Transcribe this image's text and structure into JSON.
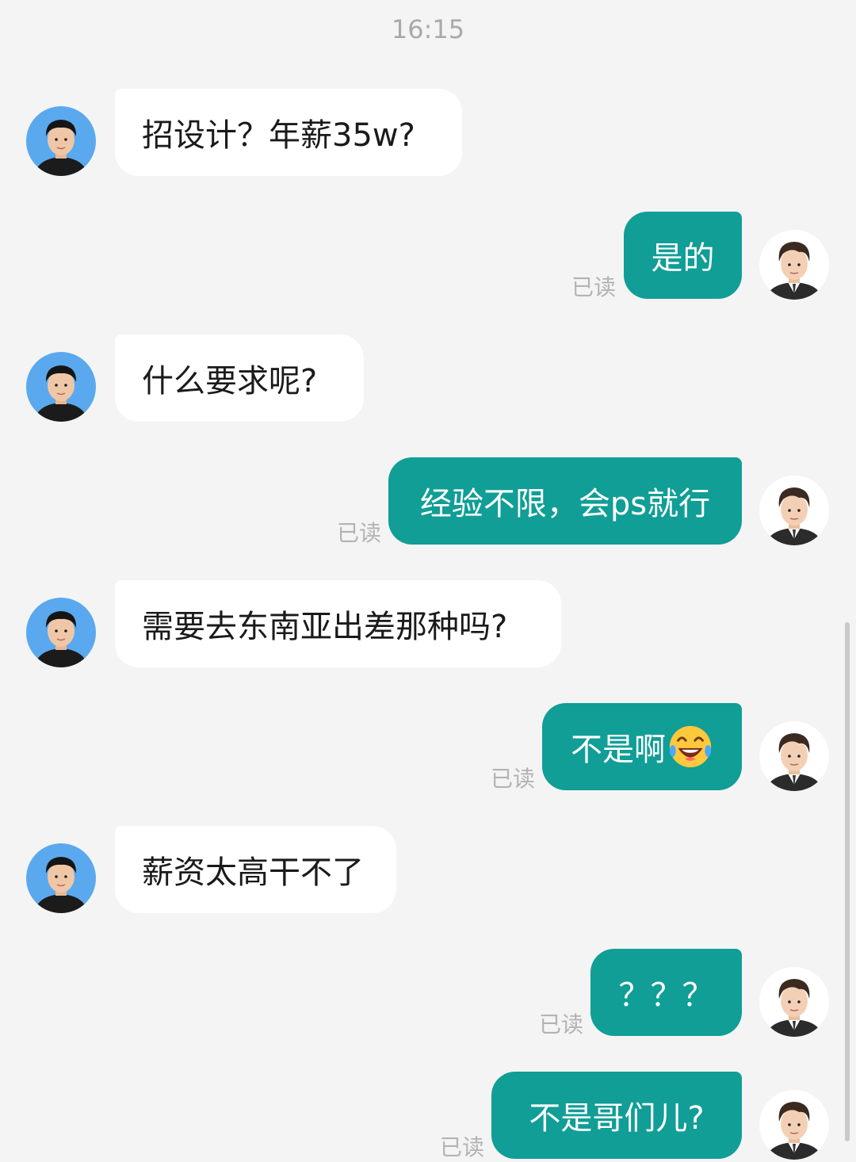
{
  "chat": {
    "timestamp": "16:15",
    "read_label": "已读",
    "messages": [
      {
        "side": "left",
        "text": "招设计？年薪35w?"
      },
      {
        "side": "right",
        "text": "是的"
      },
      {
        "side": "left",
        "text": "什么要求呢?"
      },
      {
        "side": "right",
        "text": "经验不限，会ps就行"
      },
      {
        "side": "left",
        "text": "需要去东南亚出差那种吗?"
      },
      {
        "side": "right",
        "text": "不是啊",
        "emoji": "laughing-tears-emoji"
      },
      {
        "side": "left",
        "text": "薪资太高干不了"
      },
      {
        "side": "right",
        "text": "？？？"
      },
      {
        "side": "right",
        "text": "不是哥们儿?"
      }
    ]
  },
  "colors": {
    "background": "#f4f4f4",
    "incoming_bubble": "#ffffff",
    "outgoing_bubble": "#109e96",
    "read_receipt": "#b3b3b3",
    "avatar_left_bg": "#5aa9ef"
  }
}
